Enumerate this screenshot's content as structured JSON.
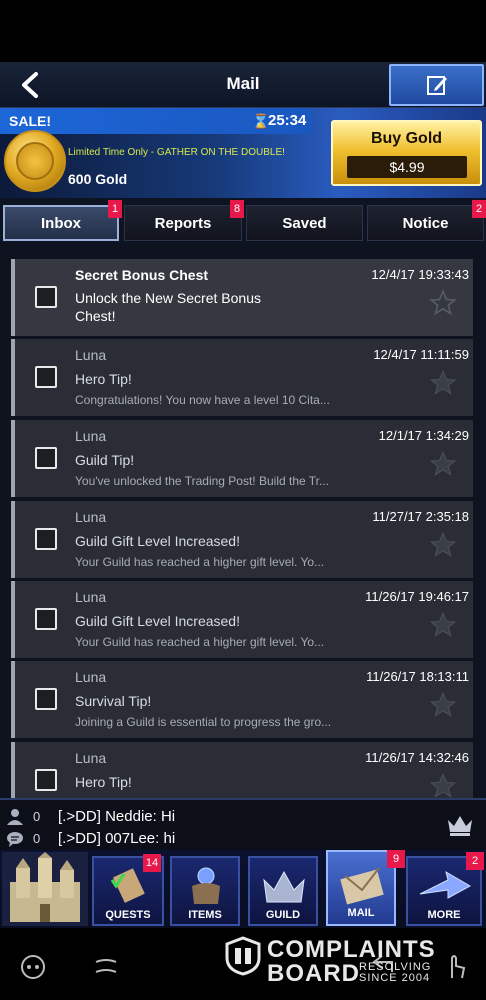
{
  "header": {
    "title": "Mail",
    "back_icon": "back-arrow-icon",
    "compose_icon": "compose-icon"
  },
  "sale": {
    "label": "SALE!",
    "timer": "25:34",
    "promo": "Limited Time Only - GATHER ON THE DOUBLE!",
    "gold": "600 Gold",
    "buy_label": "Buy Gold",
    "price": "$4.99"
  },
  "tabs": [
    {
      "label": "Inbox",
      "badge": "1",
      "active": true
    },
    {
      "label": "Reports",
      "badge": "8",
      "active": false
    },
    {
      "label": "Saved",
      "badge": "",
      "active": false
    },
    {
      "label": "Notice",
      "badge": "2",
      "active": false
    }
  ],
  "mails": [
    {
      "sender": "Secret Bonus Chest",
      "date": "12/4/17 19:33:43",
      "subject": "Unlock the New Secret Bonus Chest!",
      "preview": ""
    },
    {
      "sender": "Luna",
      "date": "12/4/17 11:11:59",
      "subject": "Hero Tip!",
      "preview": "Congratulations! You now have a level 10 Cita..."
    },
    {
      "sender": "Luna",
      "date": "12/1/17 1:34:29",
      "subject": "Guild Tip!",
      "preview": "You've unlocked the Trading Post! Build the Tr..."
    },
    {
      "sender": "Luna",
      "date": "11/27/17 2:35:18",
      "subject": "Guild Gift Level Increased!",
      "preview": "Your Guild has reached a higher gift level.  Yo..."
    },
    {
      "sender": "Luna",
      "date": "11/26/17 19:46:17",
      "subject": "Guild Gift Level Increased!",
      "preview": "Your Guild has reached a higher gift level.  Yo..."
    },
    {
      "sender": "Luna",
      "date": "11/26/17 18:13:11",
      "subject": "Survival Tip!",
      "preview": "Joining a Guild is essential to progress the gro..."
    },
    {
      "sender": "Luna",
      "date": "11/26/17 14:32:46",
      "subject": "Hero Tip!",
      "preview": ""
    }
  ],
  "chat": [
    {
      "count": "0",
      "message": "[.>DD] Neddie: Hi",
      "icon": "players-icon"
    },
    {
      "count": "0",
      "message": "[.>DD] 007Lee: hi",
      "icon": "chat-bubble-icon"
    }
  ],
  "nav": {
    "quests": {
      "label": "QUESTS",
      "badge": "14"
    },
    "items": {
      "label": "ITEMS",
      "badge": ""
    },
    "guild": {
      "label": "GUILD",
      "badge": ""
    },
    "mail": {
      "label": "MAIL",
      "badge": "9"
    },
    "more": {
      "label": "MORE",
      "badge": "2"
    }
  },
  "watermark": {
    "line1": "COMPLAINTS",
    "line2": "BOARD",
    "tag1": "RESOLVING",
    "tag2": "SINCE 2004"
  }
}
